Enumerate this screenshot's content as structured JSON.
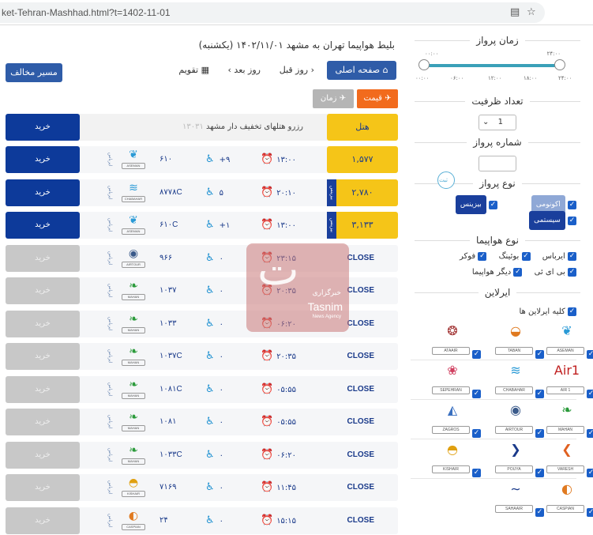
{
  "browser": {
    "url": "ket-Tehran-Mashhad.html?t=1402-11-01",
    "reader_icon": "reader-mode-icon",
    "bookmark_icon": "star-icon"
  },
  "header": {
    "title": "بلیط هواپیما تهران به مشهد ۱۴۰۲/۱۱/۰۱ (یکشنبه)",
    "home_button": "صفحه اصلی",
    "prev_day": "روز قبل",
    "next_day": "روز بعد",
    "calendar": "تقویم",
    "reverse_route_button": "مسیر مخالف",
    "sort_price": "قیمت",
    "sort_time": "زمان"
  },
  "hotel_row": {
    "label": "هتل",
    "text": "رزرو هتلهای تخفیف دار مشهد",
    "phone": "۱۳۰۳۱",
    "buy": "خرید"
  },
  "flights": [
    {
      "price": "۱,۵۷۷",
      "tag": "",
      "status": "open",
      "time": "۱۳:۰۰",
      "seats": "+۹",
      "flight_no": "۶۱۰",
      "airline": "ASEMAN",
      "plane": "ایرباس",
      "buy": "خرید"
    },
    {
      "price": "۲,۷۸۰",
      "tag": "بیزینس",
      "status": "open",
      "time": "۲۰:۱۰",
      "seats": "۵",
      "flight_no": "۸۷۷۸C",
      "airline": "CHABAHAR",
      "plane": "ایرباس",
      "buy": "خرید"
    },
    {
      "price": "۳,۱۳۳",
      "tag": "بیزینس",
      "status": "open",
      "time": "۱۳:۰۰",
      "seats": "+۱",
      "flight_no": "۶۱۰C",
      "airline": "ASEMAN",
      "plane": "ایرباس",
      "buy": "خرید"
    },
    {
      "price": "CLOSE",
      "tag": "",
      "status": "closed",
      "time": "۲۳:۱۵",
      "seats": "۰",
      "flight_no": "۹۶۶",
      "airline": "AIRTOUR",
      "plane": "ایرباس",
      "buy": "خرید"
    },
    {
      "price": "CLOSE",
      "tag": "",
      "status": "closed",
      "time": "۲۰:۳۵",
      "seats": "۰",
      "flight_no": "۱۰۳۷",
      "airline": "MAHAN",
      "plane": "ایرباس",
      "buy": "خرید"
    },
    {
      "price": "CLOSE",
      "tag": "",
      "status": "closed",
      "time": "۰۶:۲۰",
      "seats": "۰",
      "flight_no": "۱۰۳۳",
      "airline": "MAHAN",
      "plane": "ایرباس",
      "buy": "خرید"
    },
    {
      "price": "CLOSE",
      "tag": "",
      "status": "closed",
      "time": "۲۰:۳۵",
      "seats": "۰",
      "flight_no": "۱۰۳۷C",
      "airline": "MAHAN",
      "plane": "ایرباس",
      "buy": "خرید"
    },
    {
      "price": "CLOSE",
      "tag": "",
      "status": "closed",
      "time": "۰۵:۵۵",
      "seats": "۰",
      "flight_no": "۱۰۸۱C",
      "airline": "MAHAN",
      "plane": "ایرباس",
      "buy": "خرید"
    },
    {
      "price": "CLOSE",
      "tag": "",
      "status": "closed",
      "time": "۰۵:۵۵",
      "seats": "۰",
      "flight_no": "۱۰۸۱",
      "airline": "MAHAN",
      "plane": "ایرباس",
      "buy": "خرید"
    },
    {
      "price": "CLOSE",
      "tag": "",
      "status": "closed",
      "time": "۰۶:۲۰",
      "seats": "۰",
      "flight_no": "۱۰۳۳C",
      "airline": "MAHAN",
      "plane": "ایرباس",
      "buy": "خرید"
    },
    {
      "price": "CLOSE",
      "tag": "",
      "status": "closed",
      "time": "۱۱:۴۵",
      "seats": "۰",
      "flight_no": "۷۱۶۹",
      "airline": "KISHAIR",
      "plane": "ایرباس",
      "buy": "خرید"
    },
    {
      "price": "CLOSE",
      "tag": "",
      "status": "closed",
      "time": "۱۵:۱۵",
      "seats": "۰",
      "flight_no": "۲۴",
      "airline": "CASPIAN",
      "plane": "ایرباس",
      "buy": "خرید"
    }
  ],
  "sidebar": {
    "flight_time_title": "زمان پرواز",
    "time_range": {
      "from": "۰۰:۰۰",
      "to": "۲۴:۰۰",
      "ticks": [
        "۰۰:۰۰",
        "۰۶:۰۰",
        "۱۲:۰۰",
        "۱۸:۰۰",
        "۲۴:۰۰"
      ]
    },
    "capacity_title": "تعداد ظرفیت",
    "capacity_value": "1",
    "flight_number_title": "شماره پرواز",
    "flight_number_value": "",
    "flight_type_title": "نوع پرواز",
    "price_circle": "ثبت",
    "flight_types": [
      {
        "label": "اکونومی",
        "checked": true,
        "color": "#8fa8d6"
      },
      {
        "label": "بیزینس",
        "checked": true,
        "color": "#1a3f9c"
      },
      {
        "label": "سیستمی",
        "checked": true,
        "color": "#1a3f9c"
      }
    ],
    "aircraft_title": "نوع هواپیما",
    "aircraft": [
      {
        "label": "ایرباس",
        "checked": true
      },
      {
        "label": "بوئینگ",
        "checked": true
      },
      {
        "label": "فوکر",
        "checked": true
      },
      {
        "label": "بی ای ئی",
        "checked": true
      },
      {
        "label": "دیگر هواپیما",
        "checked": true
      }
    ],
    "airline_title": "ایرلاین",
    "all_airlines": "کلیه ایرلاین ها",
    "airlines": [
      "ASEMAN",
      "TABAN",
      "ATAAIR",
      "AIR 1",
      "CHABAHAR",
      "SEPEHRAN",
      "MAHAN",
      "AIRTOUR",
      "ZAGROS",
      "VARESH",
      "POUYA",
      "KISHAIR",
      "CASPIAN",
      "SAHAAIR"
    ]
  },
  "watermark": {
    "line1": "خبرگزاری",
    "line2": "Tasnim",
    "line3": "News Agency"
  }
}
